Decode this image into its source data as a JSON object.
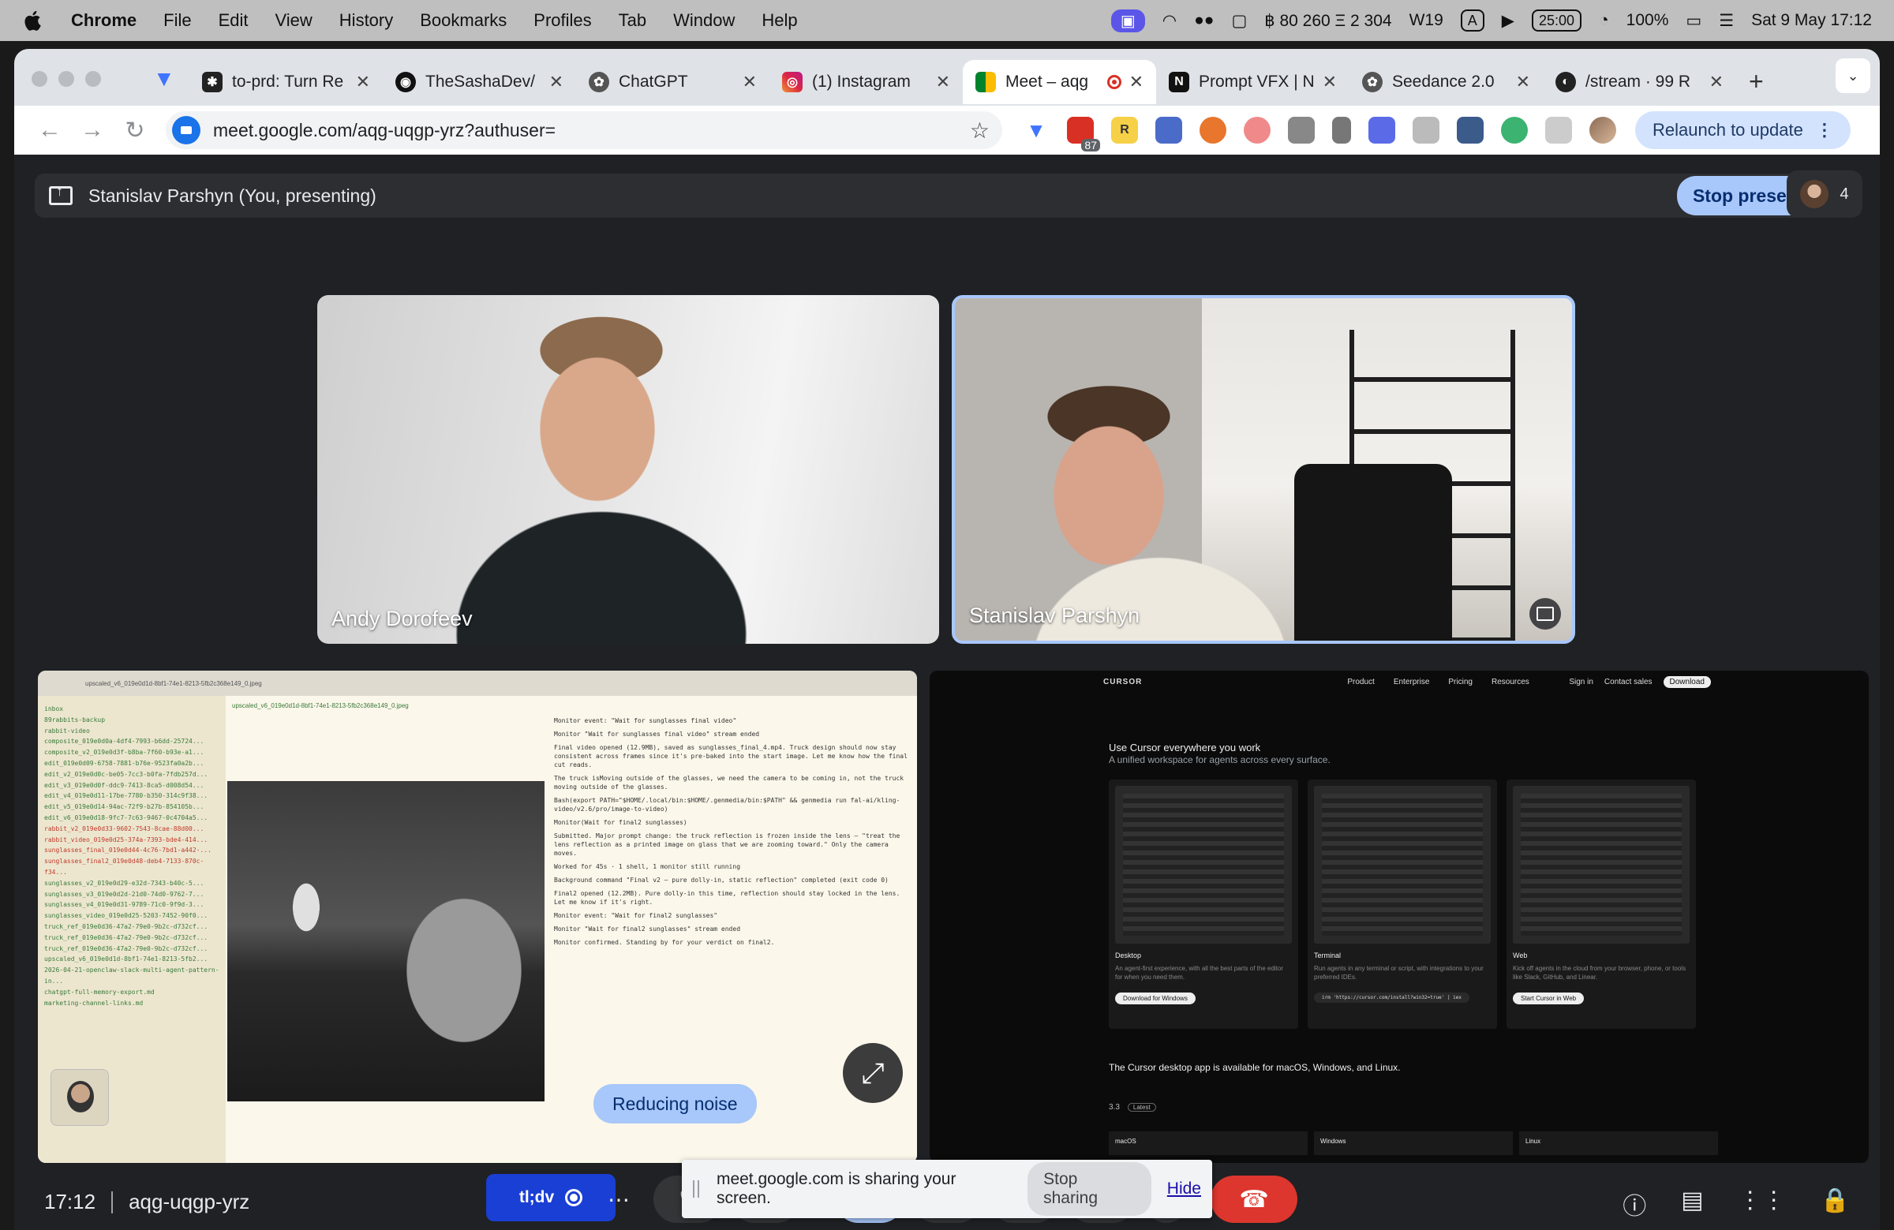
{
  "menubar": {
    "app": "Chrome",
    "items": [
      "File",
      "Edit",
      "View",
      "History",
      "Bookmarks",
      "Profiles",
      "Tab",
      "Window",
      "Help"
    ],
    "status": {
      "crypto": "฿ 80 260 Ξ 2 304",
      "week": "W19",
      "input": "A",
      "timer": "25:00",
      "battery": "100%",
      "datetime": "Sat 9 May  17:12"
    }
  },
  "tabs": [
    {
      "title": "to-prd: Turn Re",
      "color": "#222"
    },
    {
      "title": "TheSashaDev/",
      "color": "#111"
    },
    {
      "title": "ChatGPT",
      "color": "#444"
    },
    {
      "title": "(1) Instagram",
      "color": "#d6249f"
    },
    {
      "title": "Meet – aqg",
      "color": "#00832d",
      "active": true
    },
    {
      "title": "Prompt VFX | N",
      "color": "#111"
    },
    {
      "title": "Seedance 2.0",
      "color": "#444"
    },
    {
      "title": "/stream · 99 R",
      "color": "#222"
    }
  ],
  "toolbar": {
    "url": "meet.google.com/aqg-uqgp-yrz?authuser=",
    "ext_badge": "87",
    "relaunch": "Relaunch to update"
  },
  "meet": {
    "presenting_text": "Stanislav Parshyn (You, presenting)",
    "stop_presenting": "Stop presenting",
    "participant_count": "4",
    "tiles": {
      "andy": "Andy Dorofeev",
      "stas": "Stanislav Parshyn"
    },
    "reducing_noise": "Reducing noise",
    "time": "17:12",
    "code": "aqg-uqgp-yrz",
    "tldv": "tl;dv",
    "share_banner": {
      "text": "meet.google.com is sharing your screen.",
      "stop": "Stop sharing",
      "hide": "Hide"
    }
  },
  "cursor_page": {
    "logo": "CURSOR",
    "nav": [
      "Product",
      "Enterprise",
      "Pricing",
      "Resources"
    ],
    "signin": "Sign in",
    "contact": "Contact sales",
    "download": "Download",
    "headline": "Use Cursor everywhere you work",
    "subhead": "A unified workspace for agents across every surface.",
    "cards": [
      {
        "title": "Desktop",
        "desc": "An agent-first experience, with all the best parts of the editor for when you need them.",
        "button": "Download for Windows"
      },
      {
        "title": "Terminal",
        "desc": "Run agents in any terminal or script, with integrations to your preferred IDEs.",
        "button": "irm 'https://cursor.com/install?win32=true' | iex"
      },
      {
        "title": "Web",
        "desc": "Kick off agents in the cloud from your browser, phone, or tools like Slack, GitHub, and Linear.",
        "button": "Start Cursor in Web"
      }
    ],
    "available": "The Cursor desktop app is available for macOS, Windows, and Linux.",
    "version": "3.3",
    "latest": "Latest",
    "os": [
      "macOS",
      "Windows",
      "Linux"
    ]
  },
  "shared_screen": {
    "files": [
      "inbox",
      "89rabbits-backup",
      "rabbit-video",
      "composite_019e0d0a-4df4-7993-b6dd-25724...",
      "composite_v2_019e0d3f-b8ba-7f60-b93e-a1...",
      "edit_019e0d09-6758-7881-b76e-9523fa0a2b...",
      "edit_v2_019e0d0c-be05-7cc3-b0fa-7fdb257d...",
      "edit_v3_019e0d0f-ddc9-7413-8ca5-d008d54...",
      "edit_v4_019e0d11-17be-7780-b350-314c9f38...",
      "edit_v5_019e0d14-94ac-72f9-b27b-854105b...",
      "edit_v6_019e0d18-9fc7-7c63-9467-0c4704a5...",
      "rabbit_v2_019e0d33-9602-7543-8cae-88d00...",
      "rabbit_video_019e0d25-374a-7393-bde4-414...",
      "sunglasses_final_019e0d44-4c76-7bd1-a442-...",
      "sunglasses_final2_019e0d48-deb4-7133-870c-f34...",
      "sunglasses_v2_019e0d29-e32d-7343-b40c-5...",
      "sunglasses_v3_019e0d2d-21d0-74d0-9762-7...",
      "sunglasses_v4_019e0d31-9789-71c0-9f9d-3...",
      "sunglasses_video_019e0d25-5203-7452-90f0...",
      "truck_ref_019e0d36-47a2-79e0-9b2c-d732cf...",
      "truck_ref_019e0d36-47a2-79e0-9b2c-d732cf...",
      "truck_ref_019e0d36-47a2-79e0-9b2c-d732cf...",
      "upscaled_v6_019e0d1d-8bf1-74e1-8213-5fb2...",
      "2026-04-21-openclaw-slack-multi-agent-pattern-in...",
      "chatgpt-full-memory-export.md",
      "marketing-channel-links.md"
    ],
    "editor_tab": "upscaled_v6_019e0d1d-8bf1-74e1-8213-5fb2c368e149_0.jpeg",
    "terminal_lines": [
      "Monitor event: \"Wait for sunglasses final video\"",
      "Monitor \"Wait for sunglasses final video\" stream ended",
      "Final video opened (12.9MB), saved as sunglasses_final_4.mp4. Truck design should now stay consistent across frames since it's pre-baked into the start image. Let me know how the final cut reads.",
      "The truck isMoving outside of the glasses, we need the camera to be coming in, not the truck moving outside of the glasses.",
      "Bash(export PATH=\"$HOME/.local/bin:$HOME/.genmedia/bin:$PATH\" && genmedia run fal-ai/kling-video/v2.6/pro/image-to-video)",
      "Monitor(Wait for final2 sunglasses)",
      "Submitted. Major prompt change: the truck reflection is frozen inside the lens — \"treat the lens reflection as a printed image on glass that we are zooming toward.\" Only the camera moves.",
      "Worked for 45s · 1 shell, 1 monitor still running",
      "Background command \"Final v2 — pure dolly-in, static reflection\" completed (exit code 0)",
      "Final2 opened (12.2MB). Pure dolly-in this time, reflection should stay locked in the lens. Let me know if it's right.",
      "Monitor event: \"Wait for final2 sunglasses\"",
      "Monitor \"Wait for final2 sunglasses\" stream ended",
      "Monitor confirmed. Standing by for your verdict on final2."
    ]
  }
}
